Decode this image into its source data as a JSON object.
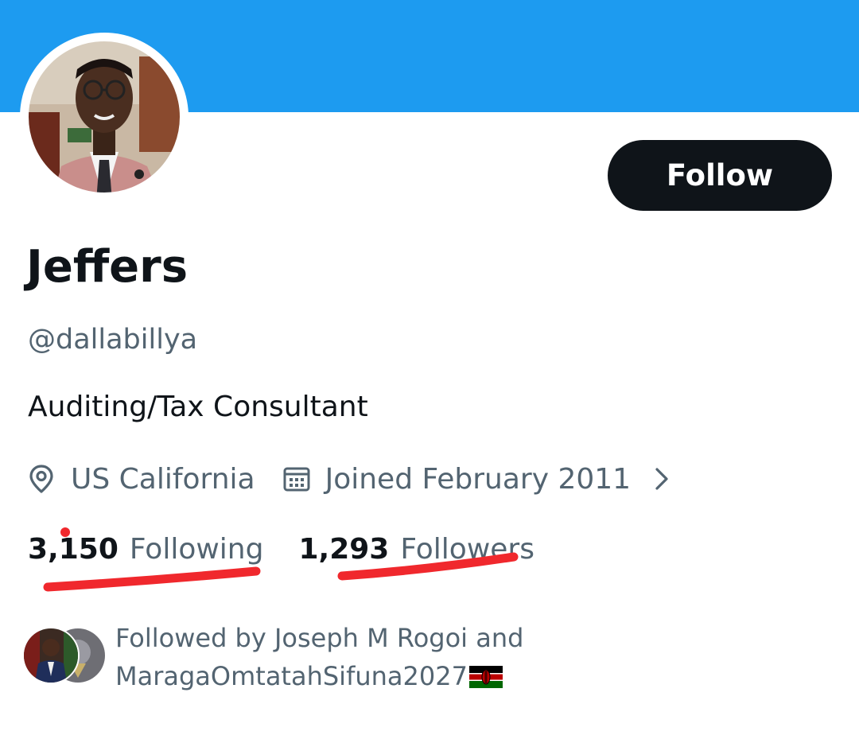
{
  "profile": {
    "display_name": "Jeffers",
    "handle": "@dallabillya",
    "bio": "Auditing/Tax Consultant",
    "location": "US California",
    "joined": "Joined February 2011",
    "following_count": "3,150",
    "following_label": "Following",
    "followers_count": "1,293",
    "followers_label": "Followers"
  },
  "actions": {
    "follow_label": "Follow"
  },
  "followed_by": {
    "line1": "Followed by Joseph M Rogoi and",
    "line2": "MaragaOmtatahSifuna2027"
  },
  "icons": {
    "location": "location-pin-icon",
    "calendar": "calendar-icon",
    "chevron": "chevron-right-icon",
    "flag": "kenya-flag-icon"
  },
  "colors": {
    "banner": "#1d9bf0",
    "button_bg": "#0f1419",
    "primary_text": "#0f1419",
    "secondary_text": "#536471",
    "annotation_red": "#f0282d"
  }
}
